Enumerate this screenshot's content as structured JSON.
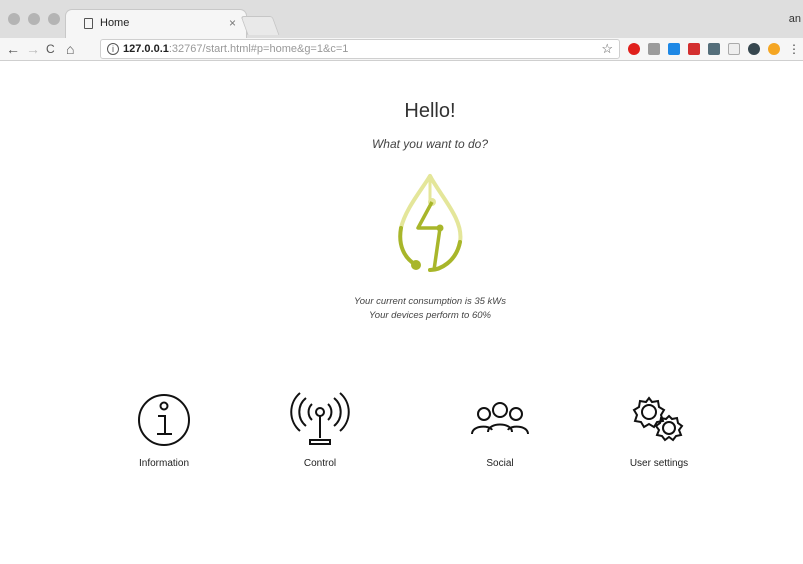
{
  "browser": {
    "tab_title": "Home",
    "tab_close": "×",
    "profile_text": "an",
    "url_host": "127.0.0.1",
    "url_rest": ":32767/start.html#p=home&g=1&c=1",
    "nav_back": "←",
    "nav_forward": "→",
    "nav_reload": "C",
    "nav_home": "⌂",
    "star": "☆",
    "menu": "⋮"
  },
  "colors": {
    "accent_dark": "#a8b62a",
    "accent_light": "#e4e69a"
  },
  "page": {
    "greeting": "Hello!",
    "question": "What you want to do?",
    "consumption_line": "Your current consumption is 35 kWs",
    "performance_line": "Your devices perform to 60%"
  },
  "actions": [
    {
      "id": "information",
      "label": "Information",
      "icon": "info-icon"
    },
    {
      "id": "control",
      "label": "Control",
      "icon": "antenna-icon"
    },
    {
      "id": "social",
      "label": "Social",
      "icon": "group-icon"
    },
    {
      "id": "user-settings",
      "label": "User settings",
      "icon": "gears-icon"
    }
  ]
}
